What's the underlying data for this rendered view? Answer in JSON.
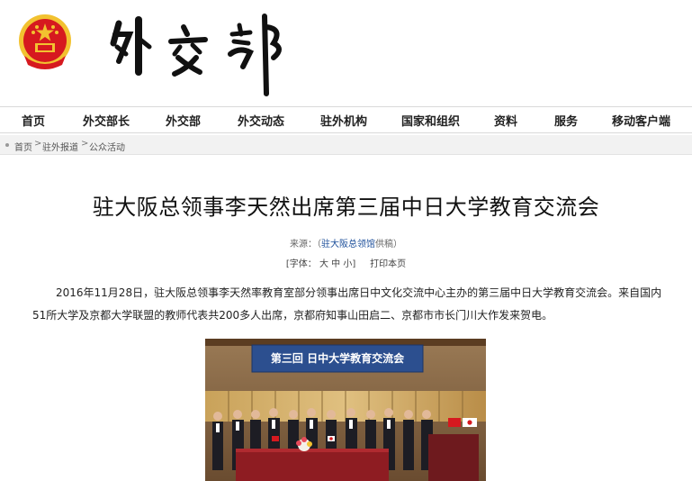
{
  "header": {
    "emblem_icon": "national-emblem-icon",
    "logo_text": "外交部"
  },
  "nav": {
    "items": [
      {
        "label": "首页"
      },
      {
        "label": "外交部长"
      },
      {
        "label": "外交部"
      },
      {
        "label": "外交动态"
      },
      {
        "label": "驻外机构"
      },
      {
        "label": "国家和组织"
      },
      {
        "label": "资料"
      },
      {
        "label": "服务"
      },
      {
        "label": "移动客户端"
      }
    ]
  },
  "breadcrumb": {
    "items": [
      "首页",
      "驻外报道",
      "公众活动"
    ],
    "separator": ">"
  },
  "article": {
    "title": "驻大阪总领事李天然出席第三届中日大学教育交流会",
    "source_label": "来源：（",
    "source_link": "驻大阪总领馆",
    "source_suffix": "供稿）",
    "font_label": "[字体：",
    "font_large": "大",
    "font_medium": "中",
    "font_small": "小]",
    "print_label": "打印本页",
    "paragraph": "2016年11月28日，驻大阪总领事李天然率教育室部分领事出席日中文化交流中心主办的第三届中日大学教育交流会。来自国内51所大学及京都大学联盟的教师代表共200多人出席，京都府知事山田启二、京都市市长门川大作发来贺电。",
    "photo_banner": "第三回  日中大学教育交流会"
  },
  "colors": {
    "link": "#1a4d99",
    "emblem_red": "#d6191f",
    "emblem_gold": "#f2c230",
    "banner_blue": "#2c4f8f"
  }
}
